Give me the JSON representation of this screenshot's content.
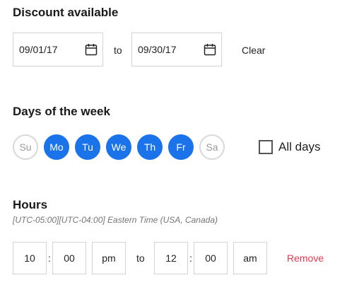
{
  "discount": {
    "title": "Discount available",
    "start_date": "09/01/17",
    "to_label": "to",
    "end_date": "09/30/17",
    "clear_label": "Clear"
  },
  "days": {
    "title": "Days of the week",
    "items": [
      {
        "label": "Su",
        "selected": false
      },
      {
        "label": "Mo",
        "selected": true
      },
      {
        "label": "Tu",
        "selected": true
      },
      {
        "label": "We",
        "selected": true
      },
      {
        "label": "Th",
        "selected": true
      },
      {
        "label": "Fr",
        "selected": true
      },
      {
        "label": "Sa",
        "selected": false
      }
    ],
    "all_days_label": "All days",
    "all_days_checked": false
  },
  "hours": {
    "title": "Hours",
    "timezone": "[UTC-05:00][UTC-04:00] Eastern Time (USA, Canada)",
    "start_hour": "10",
    "start_minute": "00",
    "start_period": "pm",
    "separator": ":",
    "to_label": "to",
    "end_hour": "12",
    "end_minute": "00",
    "end_period": "am",
    "remove_label": "Remove"
  },
  "colors": {
    "accent": "#1a73e8",
    "remove": "#e8384f"
  },
  "icons": {
    "date_picker": "calendar-icon"
  }
}
